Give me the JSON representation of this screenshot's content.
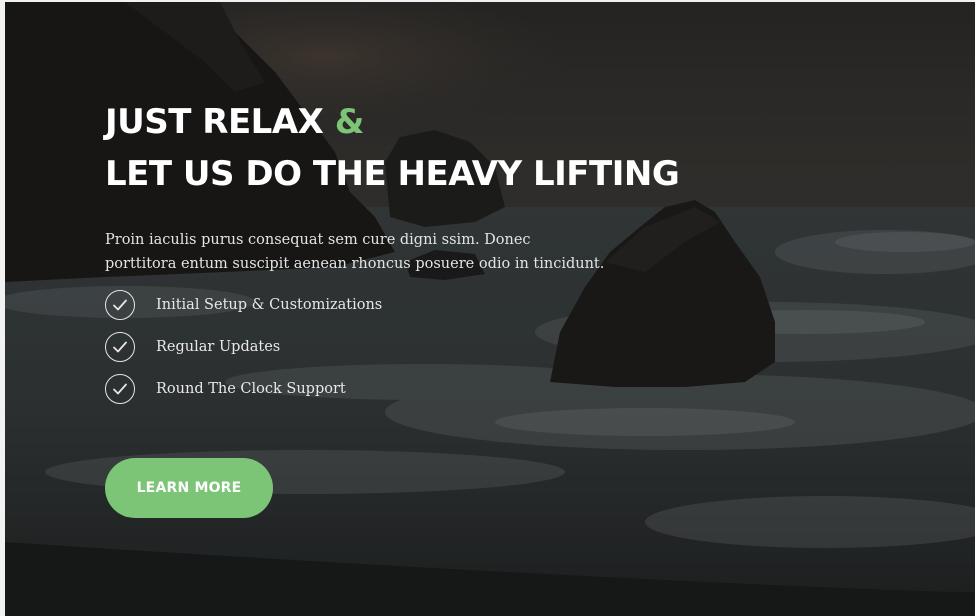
{
  "hero": {
    "headline_line1": "JUST RELAX",
    "headline_amp": "&",
    "headline_line2": "LET US DO THE HEAVY LIFTING",
    "description_line1": "Proin iaculis purus consequat sem cure  digni ssim. Donec",
    "description_line2": "porttitora entum suscipit  aenean rhoncus posuere odio in tincidunt.",
    "features": [
      {
        "label": "Initial Setup & Customizations",
        "icon": "check-circle-icon"
      },
      {
        "label": "Regular Updates",
        "icon": "check-circle-icon"
      },
      {
        "label": "Round The Clock Support",
        "icon": "check-circle-icon"
      }
    ],
    "cta_label": "LEARN MORE",
    "background": "dark ocean coastline with rocks and waves",
    "colors": {
      "accent": "#7cc576",
      "text": "#ffffff",
      "overlay": "#2b2c2c"
    }
  }
}
